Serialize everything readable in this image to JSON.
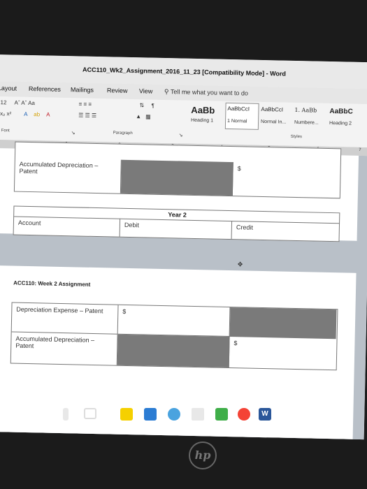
{
  "window": {
    "title": "ACC110_Wk2_Assignment_2016_11_23 [Compatibility Mode]  -  Word"
  },
  "tabs": [
    {
      "label": "Layout"
    },
    {
      "label": "References"
    },
    {
      "label": "Mailings"
    },
    {
      "label": "Review"
    },
    {
      "label": "View"
    }
  ],
  "tell_me": "Tell me what you want to do",
  "ribbon": {
    "font_size": "12",
    "font_group": "Font",
    "paragraph_group": "Paragraph",
    "styles_group": "Styles",
    "styles": [
      {
        "sample": "AaBb",
        "name": "Heading 1"
      },
      {
        "sample": "AaBbCcI",
        "name": "1 Normal"
      },
      {
        "sample": "AaBbCcI",
        "name": "Normal In..."
      },
      {
        "sample": "1. AaBb",
        "name": "Numbere..."
      },
      {
        "sample": "AaBbC",
        "name": "Heading 2"
      }
    ]
  },
  "ruler": {
    "marks": [
      "1",
      "2",
      "3",
      "4",
      "5",
      "6",
      "7"
    ]
  },
  "doc": {
    "top_table": {
      "account": "Accumulated Depreciation – Patent",
      "credit_sign": "$"
    },
    "year2_table": {
      "heading": "Year 2",
      "col_account": "Account",
      "col_debit": "Debit",
      "col_credit": "Credit"
    },
    "section_title": "ACC110: Week 2 Assignment",
    "bottom_table": {
      "row1_account": "Depreciation Expense – Patent",
      "row1_sign": "$",
      "row2_account": "Accumulated Depreciation – Patent",
      "row2_sign": "$"
    }
  },
  "colors": {
    "doc_background": "#b9c0c8",
    "shaded_cell": "#7a7a7a"
  }
}
